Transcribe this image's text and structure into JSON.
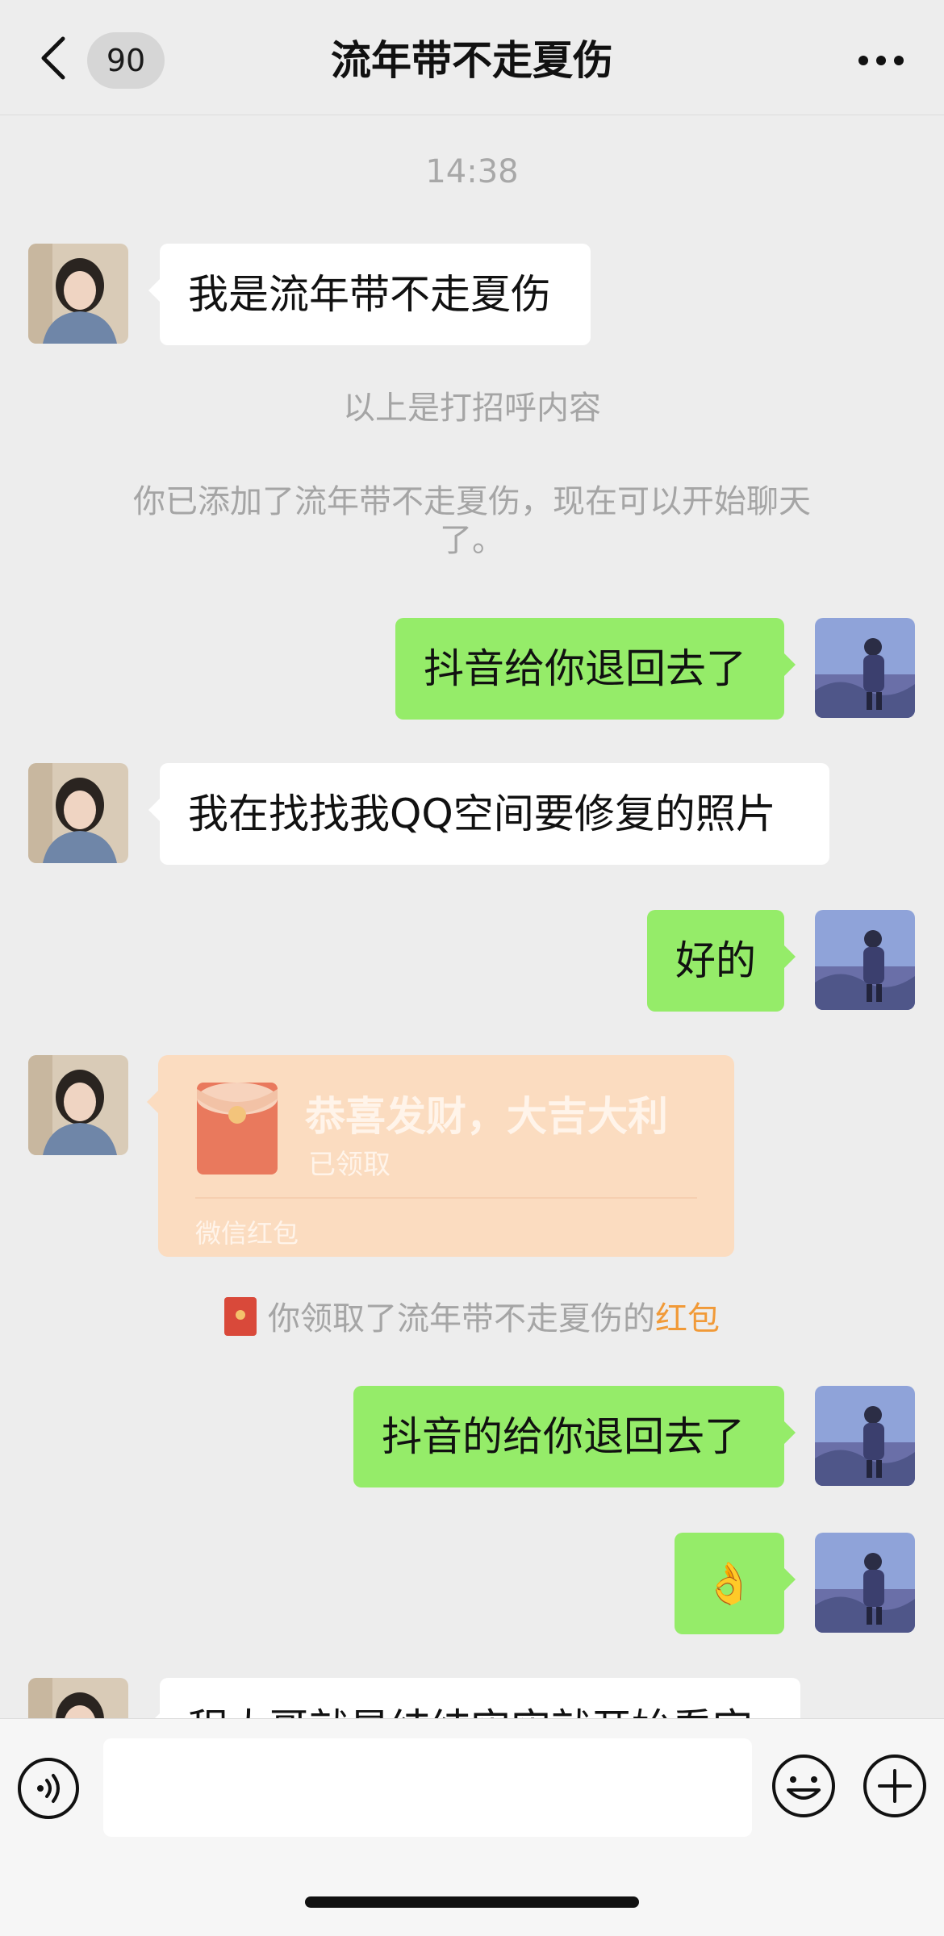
{
  "header": {
    "back_label": "<",
    "unread_count": "90",
    "title": "流年带不走夏伤",
    "more_label": "···"
  },
  "chat": {
    "time": "14:38",
    "messages": [
      {
        "side": "left",
        "text": "我是流年带不走夏伤"
      },
      {
        "side": "system",
        "text": "以上是打招呼内容"
      },
      {
        "side": "system",
        "text": "你已添加了流年带不走夏伤，现在可以开始聊天了。"
      },
      {
        "side": "right",
        "text": "抖音给你退回去了"
      },
      {
        "side": "left",
        "text": "我在找找我QQ空间要修复的照片"
      },
      {
        "side": "right",
        "text": "好的"
      },
      {
        "side": "left",
        "type": "red_packet",
        "greeting": "恭喜发财，大吉大利",
        "status": "已领取",
        "source": "微信红包"
      },
      {
        "side": "system",
        "type": "red_packet_notice",
        "text_prefix": "你领取了流年带不走夏伤的",
        "highlight": "红包"
      },
      {
        "side": "right",
        "text": "抖音的给你退回去了"
      },
      {
        "side": "right",
        "text": "👌"
      },
      {
        "side": "left",
        "text": "程大哥就是结结实实就开始看完",
        "partially_hidden": true
      }
    ]
  },
  "input_bar": {
    "voice_icon": "voice-icon",
    "input_value": "",
    "emoji_icon": "emoji-icon",
    "plus_icon": "plus-icon"
  },
  "colors": {
    "background": "#ededed",
    "bubble_green": "#95ec69",
    "bubble_white": "#ffffff",
    "red_packet": "#fbdcc0",
    "highlight_orange": "#f19a38"
  }
}
